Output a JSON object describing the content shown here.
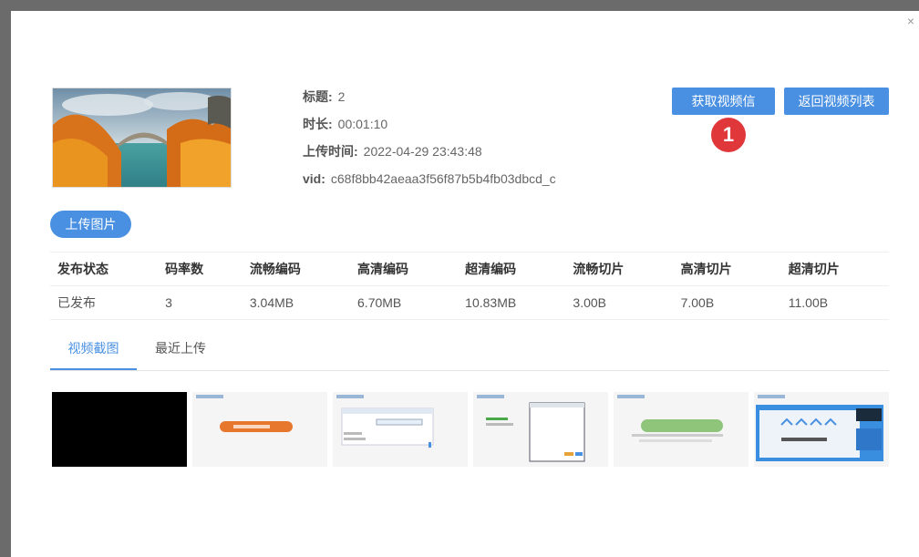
{
  "dialog": {
    "close_label": "×"
  },
  "video": {
    "title_label": "标题:",
    "title_value": "2",
    "duration_label": "时长:",
    "duration_value": "00:01:10",
    "upload_time_label": "上传时间:",
    "upload_time_value": "2022-04-29 23:43:48",
    "vid_label": "vid:",
    "vid_value": "c68f8bb42aeaa3f56f87b5b4fb03dbcd_c"
  },
  "actions": {
    "get_info": "获取视频信息",
    "back_list": "返回视频列表",
    "step_badge": "1",
    "upload_image": "上传图片"
  },
  "table": {
    "headers": [
      "发布状态",
      "码率数",
      "流畅编码",
      "高清编码",
      "超清编码",
      "流畅切片",
      "高清切片",
      "超清切片"
    ],
    "row": [
      "已发布",
      "3",
      "3.04MB",
      "6.70MB",
      "10.83MB",
      "3.00B",
      "7.00B",
      "11.00B"
    ]
  },
  "tabs": [
    {
      "label": "视频截图",
      "active": true
    },
    {
      "label": "最近上传",
      "active": false
    }
  ],
  "colors": {
    "accent": "#4a90e2",
    "badge": "#e0373a"
  }
}
